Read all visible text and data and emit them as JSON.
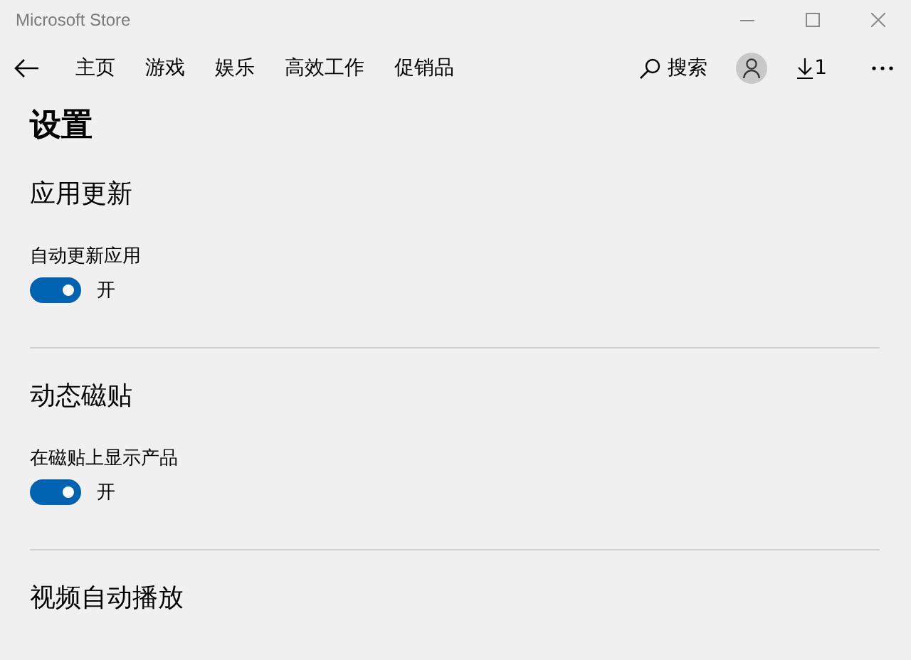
{
  "window": {
    "title": "Microsoft Store"
  },
  "nav": {
    "items": [
      {
        "label": "主页"
      },
      {
        "label": "游戏"
      },
      {
        "label": "娱乐"
      },
      {
        "label": "高效工作"
      },
      {
        "label": "促销品"
      }
    ],
    "search": "搜索",
    "downloads": "1"
  },
  "page": {
    "title": "设置"
  },
  "sections": [
    {
      "heading": "应用更新",
      "settings": [
        {
          "label": "自动更新应用",
          "on": true,
          "state_label": "开"
        }
      ]
    },
    {
      "heading": "动态磁贴",
      "settings": [
        {
          "label": "在磁贴上显示产品",
          "on": true,
          "state_label": "开"
        }
      ]
    },
    {
      "heading": "视频自动播放"
    }
  ]
}
